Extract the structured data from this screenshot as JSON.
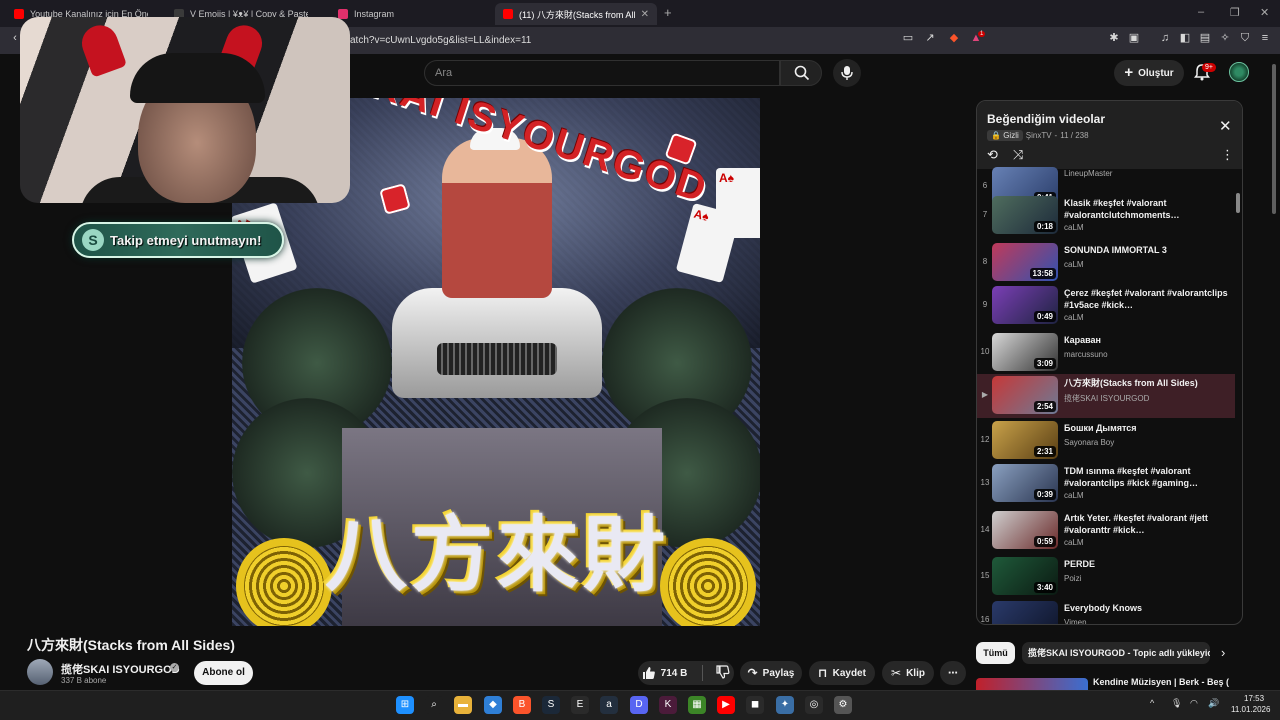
{
  "browser": {
    "tabs": [
      {
        "label": "Youtube Kanalınız için En Önemli",
        "color": "#ff0000"
      },
      {
        "label": "V Emojis | ¥ᴥ¥ | Copy & Paste",
        "color": "#3a3a3a"
      },
      {
        "label": "Instagram",
        "color": "#e1306c"
      },
      {
        "label": "(11) 八方來財(Stacks from All",
        "color": "#ff0000"
      }
    ],
    "new_tab": "+",
    "url": "/watch?v=cUwnLvgdo5g&list=LL&index=11",
    "brave_badge": "1",
    "window_controls": [
      "–",
      "❐",
      "✕"
    ]
  },
  "header": {
    "search_placeholder": "Ara",
    "create_label": "Oluştur",
    "notification_count": "9+"
  },
  "thumbnail": {
    "arc_text": "SKAI ISYOURGOD",
    "gold_text": "八方來財",
    "cards": [
      "A♠",
      "A♠",
      "A♠"
    ]
  },
  "overlay": {
    "follow_text": "Takip etmeyi unutmayın!",
    "follow_icon": "S"
  },
  "video": {
    "title": "八方來財(Stacks from All Sides)",
    "channel": "揽佬SKAI ISYOURGOD",
    "subscribers": "337 B abone",
    "subscribe_label": "Abone ol",
    "likes": "714 B",
    "share_label": "Paylaş",
    "save_label": "Kaydet",
    "clip_label": "Klip",
    "more_label": "⋯"
  },
  "playlist": {
    "title": "Beğendiğim videolar",
    "privacy": "Gizli",
    "owner": "ŞinxTV",
    "position": "11 / 238",
    "items": [
      {
        "index": "6",
        "title": "",
        "channel": "LineupMaster",
        "duration": "0:41",
        "thumb": [
          "#6781b5",
          "#2b3e6b"
        ]
      },
      {
        "index": "7",
        "title": "Klasik #keşfet #valorant #valorantclutchmoments…",
        "channel": "caLM",
        "duration": "0:18",
        "thumb": [
          "#4f6d5e",
          "#1d2a3a"
        ]
      },
      {
        "index": "8",
        "title": "SONUNDA IMMORTAL 3",
        "channel": "caLM",
        "duration": "13:58",
        "thumb": [
          "#c03a5a",
          "#3152b0"
        ]
      },
      {
        "index": "9",
        "title": "Çerez #keşfet #valorant #valorantclips #1v5ace #kick…",
        "channel": "caLM",
        "duration": "0:49",
        "thumb": [
          "#7b3fb6",
          "#1e2340"
        ]
      },
      {
        "index": "10",
        "title": "Караван",
        "channel": "marcussuno",
        "duration": "3:09",
        "thumb": [
          "#d8d8d8",
          "#333333"
        ]
      },
      {
        "index": "▶",
        "title": "八方來財(Stacks from All Sides)",
        "channel": "揽佬SKAI ISYOURGOD",
        "duration": "2:54",
        "thumb": [
          "#c63838",
          "#6d7a95"
        ],
        "active": true
      },
      {
        "index": "12",
        "title": "Бошки Дымятся",
        "channel": "Sayonara Boy",
        "duration": "2:31",
        "thumb": [
          "#c9a24a",
          "#5a3f14"
        ]
      },
      {
        "index": "13",
        "title": "TDM ısınma #keşfet #valorant #valorantclips #kick #gaming…",
        "channel": "caLM",
        "duration": "0:39",
        "thumb": [
          "#8aa0c0",
          "#2a3550"
        ]
      },
      {
        "index": "14",
        "title": "Artık Yeter. #keşfet #valorant #jett #valoranttr #kick…",
        "channel": "caLM",
        "duration": "0:59",
        "thumb": [
          "#cfcfcf",
          "#6a2a2a"
        ]
      },
      {
        "index": "15",
        "title": "PERDE",
        "channel": "Poizi",
        "duration": "3:40",
        "thumb": [
          "#1f5a3a",
          "#0b1a12"
        ]
      },
      {
        "index": "16",
        "title": "Everybody Knows",
        "channel": "Vimen",
        "duration": "",
        "thumb": [
          "#2a3a6a",
          "#0e1428"
        ]
      }
    ]
  },
  "related": {
    "chip_all": "Tümü",
    "chip_topic": "揽佬SKAI ISYOURGOD - Topic adlı yükleyici",
    "first_title": "Kendine Müzisyen | Berk - Beş ("
  },
  "taskbar": {
    "time": "17:53",
    "date": "11.01.2026",
    "apps": [
      {
        "glyph": "⊞",
        "color": "#1e90ff"
      },
      {
        "glyph": "⌕",
        "color": "#1f1f1f"
      },
      {
        "glyph": "▬",
        "color": "#e8b23a"
      },
      {
        "glyph": "◆",
        "color": "#2f7fd6"
      },
      {
        "glyph": "B",
        "color": "#fb542b"
      },
      {
        "glyph": "S",
        "color": "#1b2838"
      },
      {
        "glyph": "E",
        "color": "#2a2a2a"
      },
      {
        "glyph": "a",
        "color": "#232f3e"
      },
      {
        "glyph": "D",
        "color": "#5865f2"
      },
      {
        "glyph": "K",
        "color": "#4b1b3a"
      },
      {
        "glyph": "▦",
        "color": "#3c8527"
      },
      {
        "glyph": "▶",
        "color": "#ff0000"
      },
      {
        "glyph": "◼",
        "color": "#2a2a2a"
      },
      {
        "glyph": "✦",
        "color": "#3a6ea5"
      },
      {
        "glyph": "◎",
        "color": "#2a2a2a"
      },
      {
        "glyph": "⚙",
        "color": "#555555"
      }
    ]
  }
}
